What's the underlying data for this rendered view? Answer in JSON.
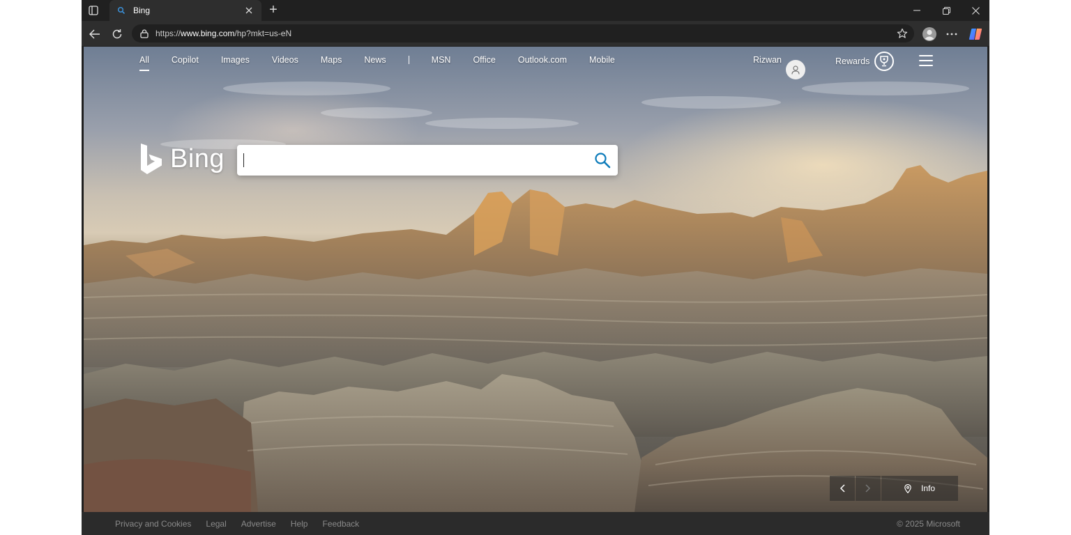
{
  "browser": {
    "tab_title": "Bing",
    "new_tab_symbol": "+",
    "url_prefix": "https://",
    "url_host": "www.bing.com",
    "url_path": "/hp?mkt=us-eN",
    "icons": [
      "tab-actions-icon",
      "search-icon",
      "close-icon",
      "back-icon",
      "refresh-icon",
      "lock-icon",
      "star-icon",
      "profile-icon",
      "more-icon",
      "copilot-icon",
      "minimize-icon",
      "restore-icon",
      "window-close-icon"
    ]
  },
  "bing": {
    "nav": {
      "items": [
        "All",
        "Copilot",
        "Images",
        "Videos",
        "Maps",
        "News"
      ],
      "items2": [
        "MSN",
        "Office",
        "Outlook.com",
        "Mobile"
      ],
      "active": "All"
    },
    "user_name": "Rizwan",
    "rewards_label": "Rewards",
    "logo_text": "Bing",
    "search": {
      "value": "",
      "placeholder": ""
    },
    "image_info_label": "Info",
    "footer": {
      "links": [
        "Privacy and Cookies",
        "Legal",
        "Advertise",
        "Help",
        "Feedback"
      ],
      "copyright": "© 2025 Microsoft"
    }
  },
  "colors": {
    "browser_frame": "#202020",
    "toolbar": "#2e2e2e",
    "bing_accent": "#0c7bba",
    "footer_bg": "#2b2b2b"
  }
}
